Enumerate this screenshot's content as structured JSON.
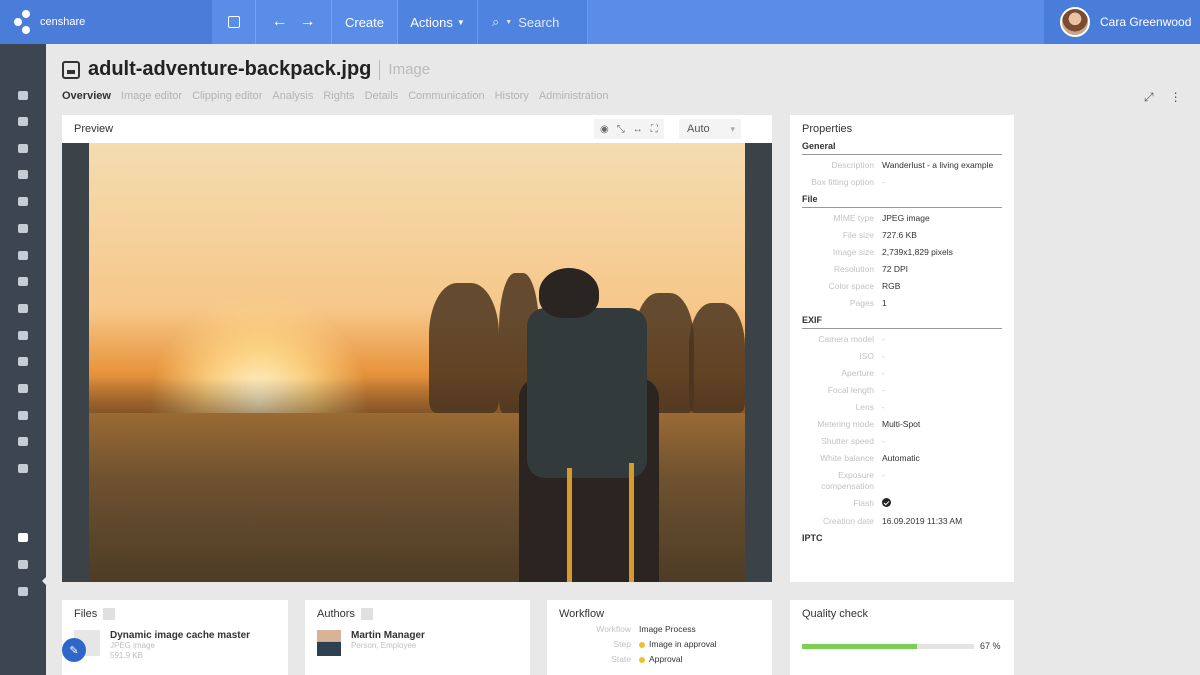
{
  "app": {
    "logo_text": "censhare",
    "create_label": "Create",
    "actions_label": "Actions",
    "search_label": "Search",
    "user_name": "Cara Greenwood"
  },
  "asset": {
    "title": "adult-adventure-backpack.jpg",
    "type": "Image"
  },
  "tabs": [
    "Overview",
    "Image editor",
    "Clipping editor",
    "Analysis",
    "Rights",
    "Details",
    "Communication",
    "History",
    "Administration"
  ],
  "preview": {
    "title": "Preview",
    "zoom_value": "Auto"
  },
  "properties": {
    "title": "Properties",
    "sections": [
      {
        "name": "General",
        "rows": [
          {
            "key": "Description",
            "value": "Wanderlust - a living example"
          },
          {
            "key": "Box fitting option",
            "value": "-"
          }
        ]
      },
      {
        "name": "File",
        "rows": [
          {
            "key": "MIME type",
            "value": "JPEG image"
          },
          {
            "key": "File size",
            "value": "727.6 KB"
          },
          {
            "key": "Image size",
            "value": "2,739x1,829 pixels"
          },
          {
            "key": "Resolution",
            "value": "72 DPI"
          },
          {
            "key": "Color space",
            "value": "RGB"
          },
          {
            "key": "Pages",
            "value": "1"
          }
        ]
      },
      {
        "name": "EXIF",
        "rows": [
          {
            "key": "Camera model",
            "value": "-"
          },
          {
            "key": "ISO",
            "value": "-"
          },
          {
            "key": "Aperture",
            "value": "-"
          },
          {
            "key": "Focal length",
            "value": "-"
          },
          {
            "key": "Lens",
            "value": "-"
          },
          {
            "key": "Metering mode",
            "value": "Multi-Spot"
          },
          {
            "key": "Shutter speed",
            "value": "-"
          },
          {
            "key": "White balance",
            "value": "Automatic"
          },
          {
            "key": "Exposure compensation",
            "value": "-"
          },
          {
            "key": "Flash",
            "value": ""
          },
          {
            "key": "Creation date",
            "value": "16.09.2019 11:33 AM"
          }
        ]
      },
      {
        "name": "IPTC",
        "rows": []
      }
    ]
  },
  "files": {
    "title": "Files",
    "item_title": "Dynamic image cache master",
    "item_type": "JPEG image",
    "item_size": "591.9 KB"
  },
  "authors": {
    "title": "Authors",
    "name": "Martin Manager",
    "sub": "Person, Employee"
  },
  "workflow": {
    "title": "Workflow",
    "rows": [
      {
        "key": "Workflow",
        "value": "Image Process"
      },
      {
        "key": "Step",
        "value": "Image in approval"
      },
      {
        "key": "State",
        "value": "Approval"
      }
    ]
  },
  "quality": {
    "title": "Quality check",
    "percent_label": "67 %",
    "value": 0.67,
    "bar_color": "#7bcf54"
  },
  "colors": {
    "topbar": "#5a8de8",
    "sidebar": "#3c4550",
    "accent": "#2f66c9"
  }
}
